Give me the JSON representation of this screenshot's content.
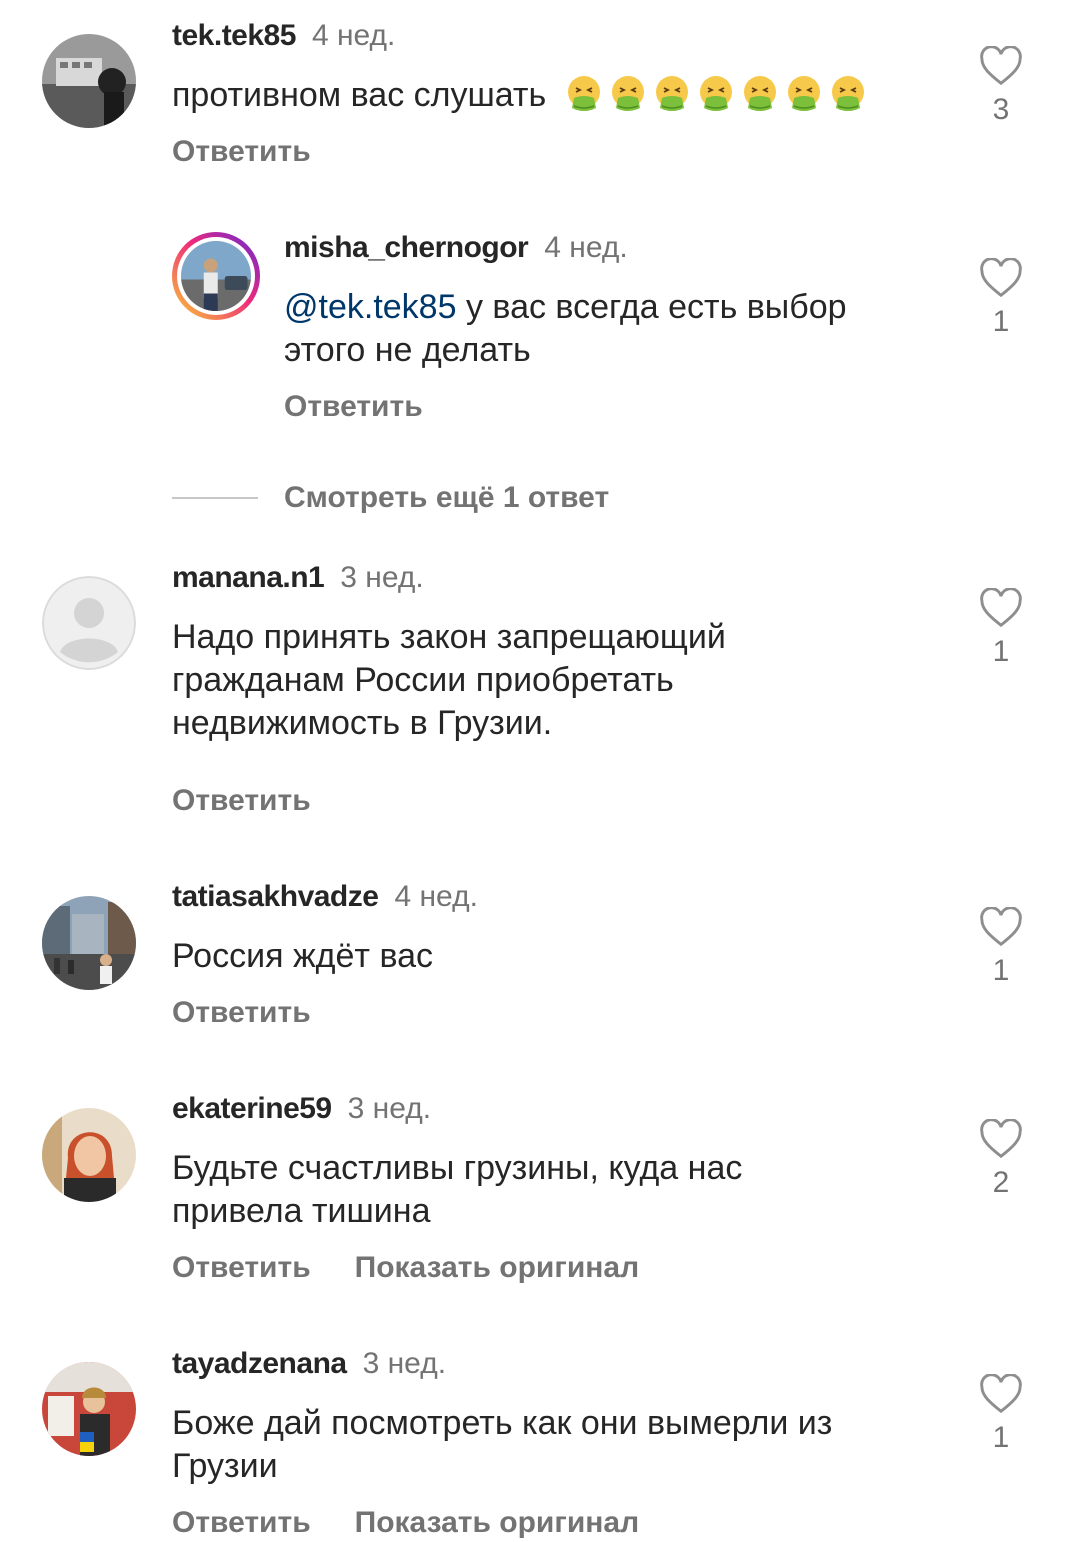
{
  "comments": [
    {
      "username": "tek.tek85",
      "time": "4 нед.",
      "text": "противном вас слушать",
      "emoji": "nauseated-face",
      "emoji_count": 7,
      "likes": "3",
      "reply": "Ответить"
    },
    {
      "username": "misha_chernogor",
      "time": "4 нед.",
      "mention": "@tek.tek85",
      "text": " у вас всегда есть выбор этого не делать",
      "likes": "1",
      "reply": "Ответить"
    },
    {
      "username": "manana.n1",
      "time": "3 нед.",
      "text": "Надо принять закон запрещающий гражданам России приобретать недвижимость в  Грузии.",
      "likes": "1",
      "reply": "Ответить"
    },
    {
      "username": "tatiasakhvadze",
      "time": "4 нед.",
      "text": "Россия ждёт вас",
      "likes": "1",
      "reply": "Ответить"
    },
    {
      "username": "ekaterine59",
      "time": "3 нед.",
      "text": "Будьте счастливы грузины, куда нас привела тишина",
      "likes": "2",
      "reply": "Ответить",
      "show_original": "Показать оригинал"
    },
    {
      "username": "tayadzenana",
      "time": "3 нед.",
      "text": "Боже дай посмотреть как они вымерли из Грузии",
      "likes": "1",
      "reply": "Ответить",
      "show_original": "Показать оригинал"
    }
  ],
  "more_replies_label": "Смотреть ещё 1 ответ",
  "icons": {
    "like": "heart-outline-icon",
    "emoji": "nauseated-face-emoji"
  }
}
